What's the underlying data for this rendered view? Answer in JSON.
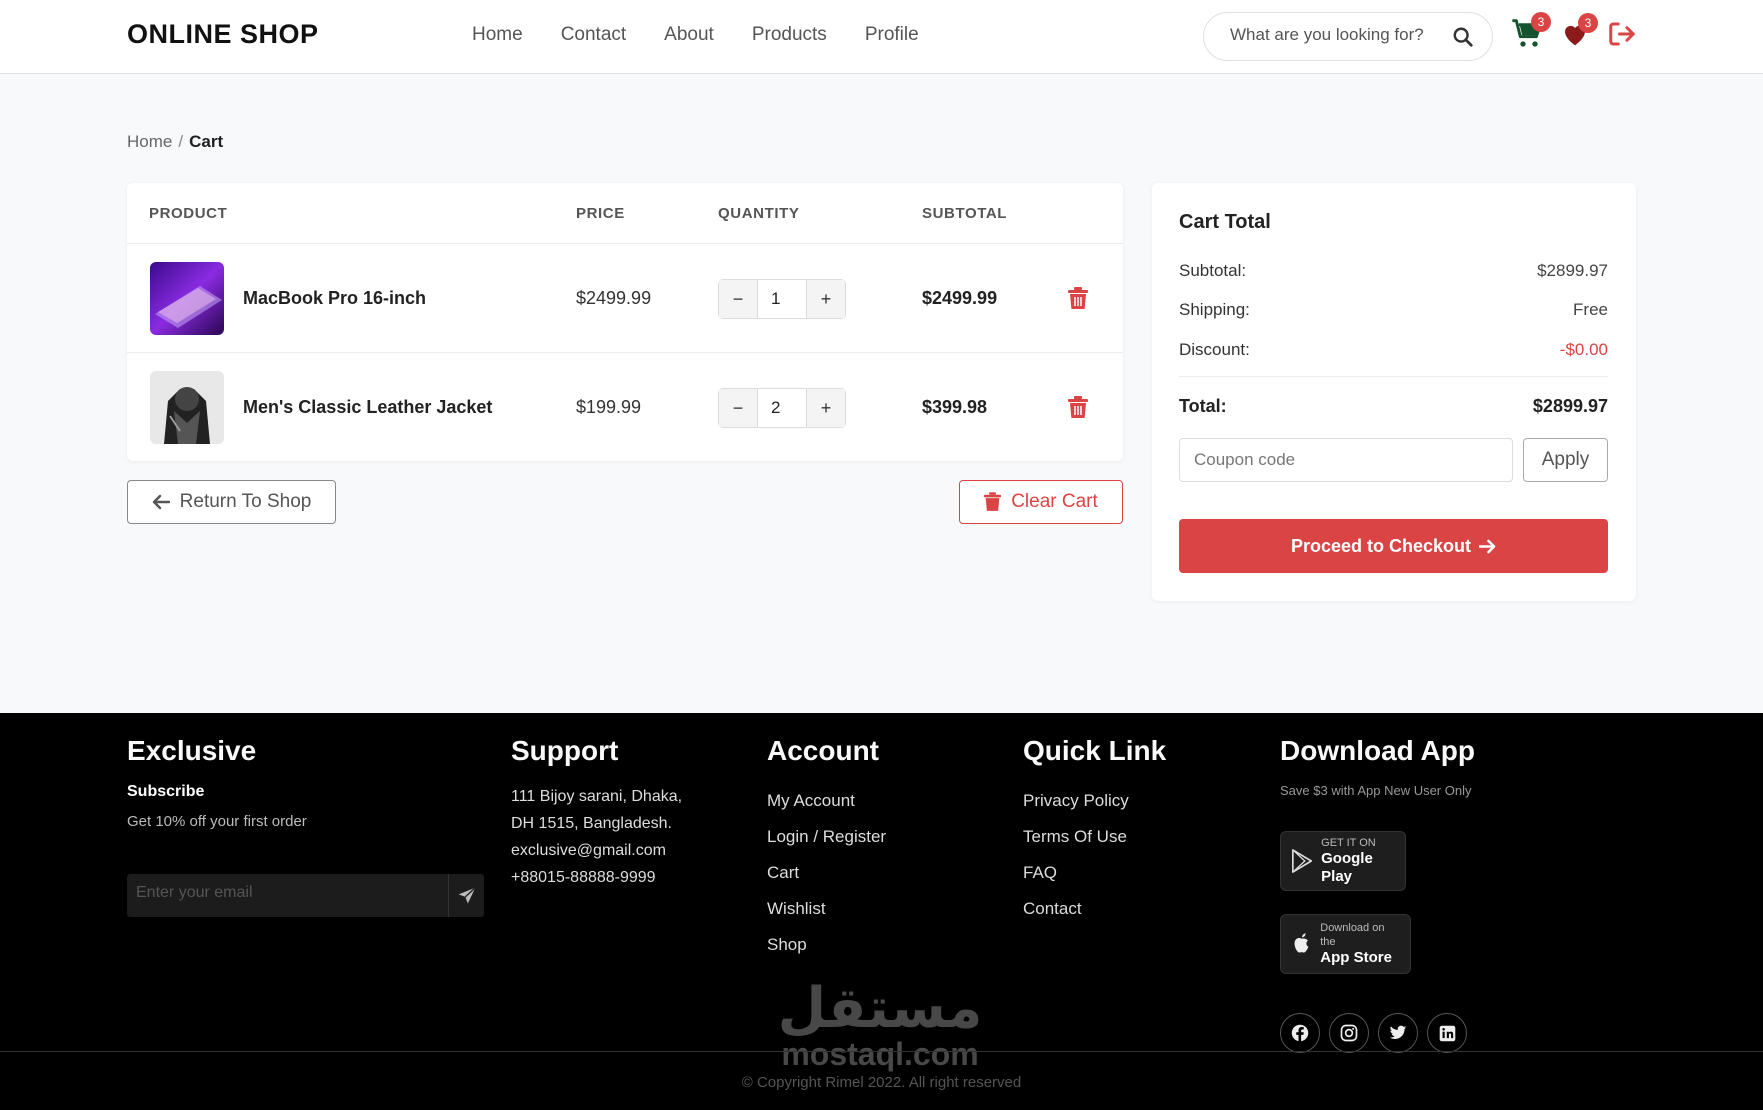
{
  "header": {
    "logo": "ONLINE SHOP",
    "nav": [
      "Home",
      "Contact",
      "About",
      "Products",
      "Profile"
    ],
    "search_placeholder": "What are you looking for?",
    "cart_count": "3",
    "wishlist_count": "3"
  },
  "breadcrumb": {
    "home": "Home",
    "separator": "/",
    "current": "Cart"
  },
  "table": {
    "headers": {
      "product": "PRODUCT",
      "price": "PRICE",
      "quantity": "QUANTITY",
      "subtotal": "SUBTOTAL"
    },
    "rows": [
      {
        "name": "MacBook Pro 16-inch",
        "price": "$2499.99",
        "quantity": "1",
        "subtotal": "$2499.99"
      },
      {
        "name": "Men's Classic Leather Jacket",
        "price": "$199.99",
        "quantity": "2",
        "subtotal": "$399.98"
      }
    ],
    "minus": "−",
    "plus": "+"
  },
  "actions": {
    "return_label": "Return To Shop",
    "clear_label": "Clear Cart"
  },
  "totals": {
    "title": "Cart Total",
    "subtotal_label": "Subtotal:",
    "subtotal_value": "$2899.97",
    "shipping_label": "Shipping:",
    "shipping_value": "Free",
    "discount_label": "Discount:",
    "discount_value": "-$0.00",
    "total_label": "Total:",
    "total_value": "$2899.97",
    "coupon_placeholder": "Coupon code",
    "apply_label": "Apply",
    "checkout_label": "Proceed to Checkout"
  },
  "footer": {
    "exclusive": {
      "title": "Exclusive",
      "subscribe": "Subscribe",
      "offer": "Get 10% off your first order",
      "email_placeholder": "Enter your email"
    },
    "support": {
      "title": "Support",
      "address_1": "111 Bijoy sarani, Dhaka,",
      "address_2": "DH 1515, Bangladesh.",
      "email": "exclusive@gmail.com",
      "phone": "+88015-88888-9999"
    },
    "account": {
      "title": "Account",
      "links": [
        "My Account",
        "Login / Register",
        "Cart",
        "Wishlist",
        "Shop"
      ]
    },
    "quick": {
      "title": "Quick Link",
      "links": [
        "Privacy Policy",
        "Terms Of Use",
        "FAQ",
        "Contact"
      ]
    },
    "app": {
      "title": "Download App",
      "note": "Save $3 with App New User Only",
      "google_small": "GET IT ON",
      "google_big": "Google Play",
      "apple_small": "Download on the",
      "apple_big": "App Store"
    },
    "copyright": "© Copyright Rimel 2022. All right reserved",
    "watermark_arabic": "مستقل",
    "watermark_latin": "mostaql.com"
  },
  "colors": {
    "accent": "#db4444",
    "cart_icon": "#14532d",
    "footer_bg": "#000000"
  }
}
